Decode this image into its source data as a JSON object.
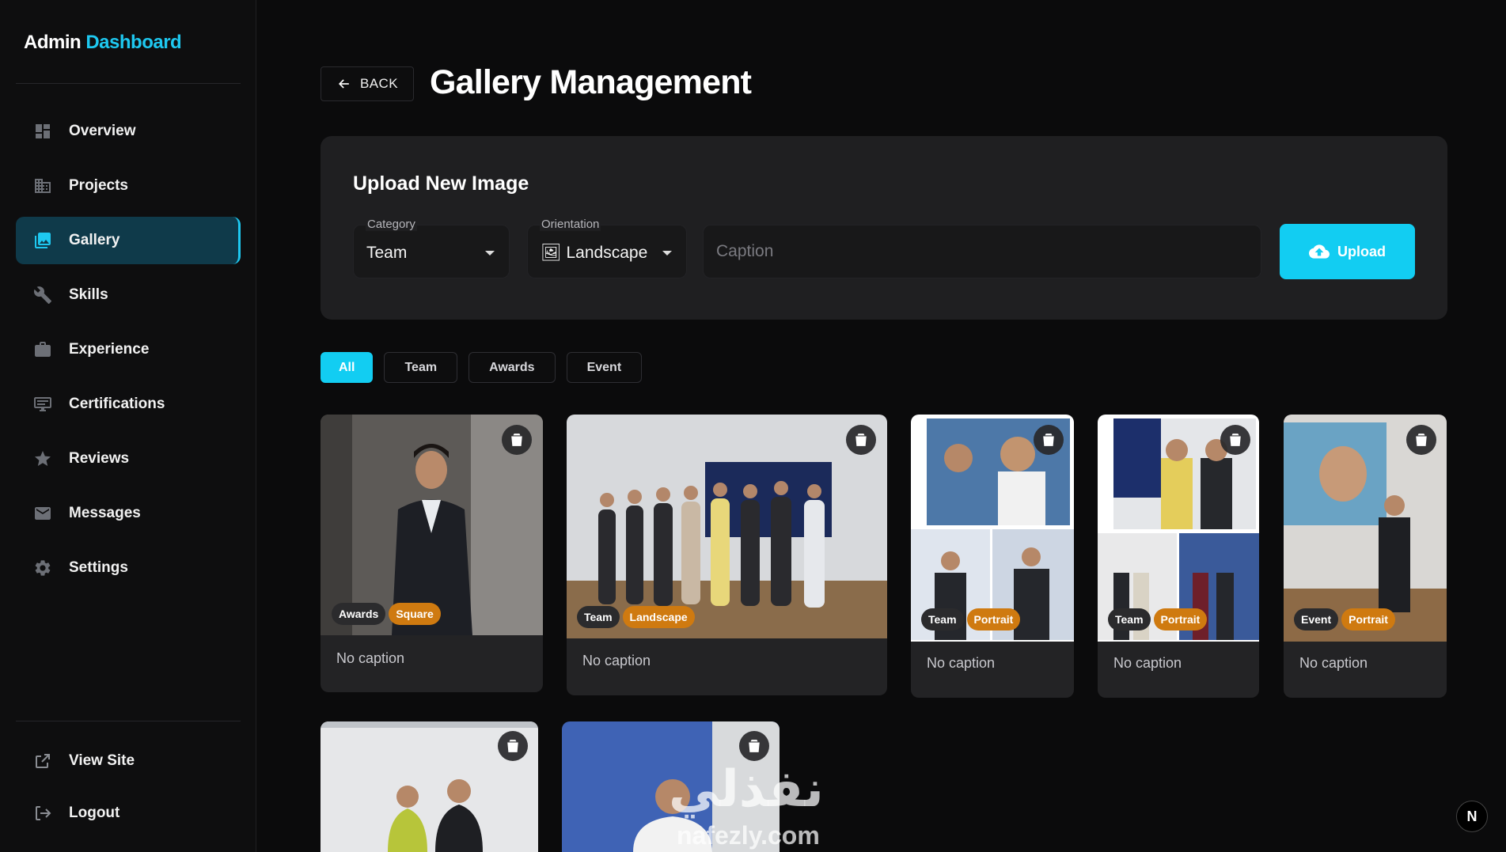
{
  "brand": {
    "part1": "Admin",
    "part2": "Dashboard"
  },
  "nav": [
    {
      "label": "Overview",
      "icon": "dashboard-icon",
      "active": false
    },
    {
      "label": "Projects",
      "icon": "building-icon",
      "active": false
    },
    {
      "label": "Gallery",
      "icon": "gallery-icon",
      "active": true
    },
    {
      "label": "Skills",
      "icon": "wrench-icon",
      "active": false
    },
    {
      "label": "Experience",
      "icon": "briefcase-icon",
      "active": false
    },
    {
      "label": "Certifications",
      "icon": "certificate-icon",
      "active": false
    },
    {
      "label": "Reviews",
      "icon": "star-icon",
      "active": false
    },
    {
      "label": "Messages",
      "icon": "mail-icon",
      "active": false
    },
    {
      "label": "Settings",
      "icon": "gear-icon",
      "active": false
    }
  ],
  "bottom_nav": [
    {
      "label": "View Site",
      "icon": "external-link-icon"
    },
    {
      "label": "Logout",
      "icon": "logout-icon"
    }
  ],
  "header": {
    "back_label": "BACK",
    "title": "Gallery Management"
  },
  "upload": {
    "title": "Upload New Image",
    "category_label": "Category",
    "category_value": "Team",
    "orientation_label": "Orientation",
    "orientation_value": "🖼 Landscape",
    "caption_placeholder": "Caption",
    "button_label": "Upload"
  },
  "filters": [
    {
      "label": "All",
      "active": true
    },
    {
      "label": "Team",
      "active": false
    },
    {
      "label": "Awards",
      "active": false
    },
    {
      "label": "Event",
      "active": false
    }
  ],
  "gallery": [
    {
      "category": "Awards",
      "orientation": "Square",
      "caption": "No caption"
    },
    {
      "category": "Team",
      "orientation": "Landscape",
      "caption": "No caption"
    },
    {
      "category": "Team",
      "orientation": "Portrait",
      "caption": "No caption"
    },
    {
      "category": "Team",
      "orientation": "Portrait",
      "caption": "No caption"
    },
    {
      "category": "Event",
      "orientation": "Portrait",
      "caption": "No caption"
    }
  ],
  "watermark": {
    "arabic": "نفذلي",
    "latin": "nafezly.com"
  },
  "corner_button": "N"
}
